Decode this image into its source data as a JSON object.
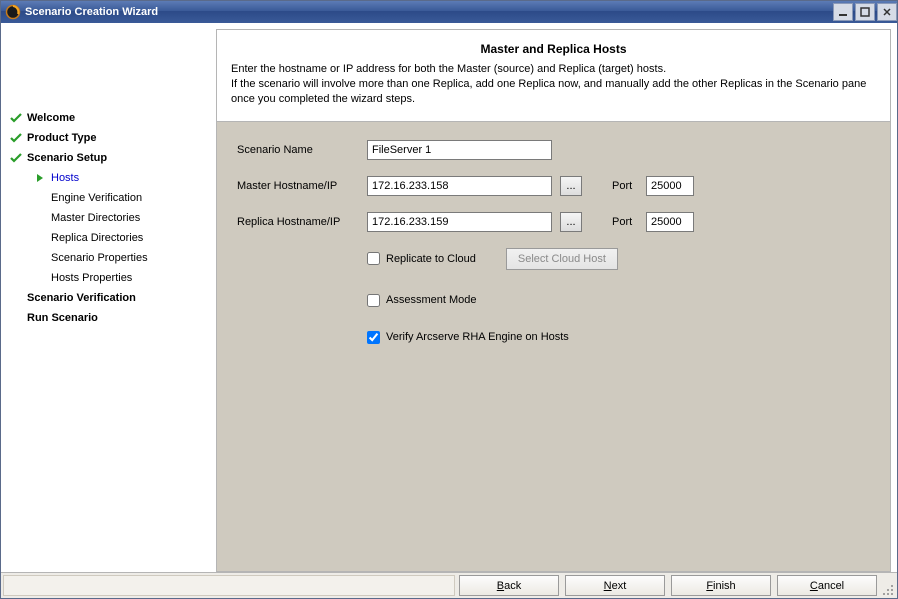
{
  "window": {
    "title": "Scenario Creation Wizard"
  },
  "nav": {
    "welcome": "Welcome",
    "product_type": "Product Type",
    "scenario_setup": "Scenario Setup",
    "hosts": "Hosts",
    "engine_verification": "Engine Verification",
    "master_directories": "Master Directories",
    "replica_directories": "Replica Directories",
    "scenario_properties": "Scenario Properties",
    "hosts_properties": "Hosts Properties",
    "scenario_verification": "Scenario Verification",
    "run_scenario": "Run Scenario"
  },
  "header": {
    "title": "Master and Replica Hosts",
    "line1": "Enter the hostname or IP address for both the Master (source) and Replica (target) hosts.",
    "line2": "If the scenario will involve more than one Replica, add one Replica now, and manually add the other Replicas in the Scenario pane once you completed the wizard steps."
  },
  "form": {
    "scenario_name_label": "Scenario Name",
    "scenario_name_value": "FileServer 1",
    "master_label": "Master Hostname/IP",
    "master_value": "172.16.233.158",
    "master_port_label": "Port",
    "master_port_value": "25000",
    "replica_label": "Replica Hostname/IP",
    "replica_value": "172.16.233.159",
    "replica_port_label": "Port",
    "replica_port_value": "25000",
    "browse_dots": "...",
    "replicate_cloud": "Replicate to Cloud",
    "select_cloud_host": "Select Cloud Host",
    "assessment_mode": "Assessment Mode",
    "verify_engine": "Verify  Arcserve  RHA Engine on Hosts"
  },
  "footer": {
    "back": "ack",
    "back_u": "B",
    "next": "ext",
    "next_u": "N",
    "finish": "inish",
    "finish_u": "F",
    "cancel": "ancel",
    "cancel_u": "C"
  }
}
